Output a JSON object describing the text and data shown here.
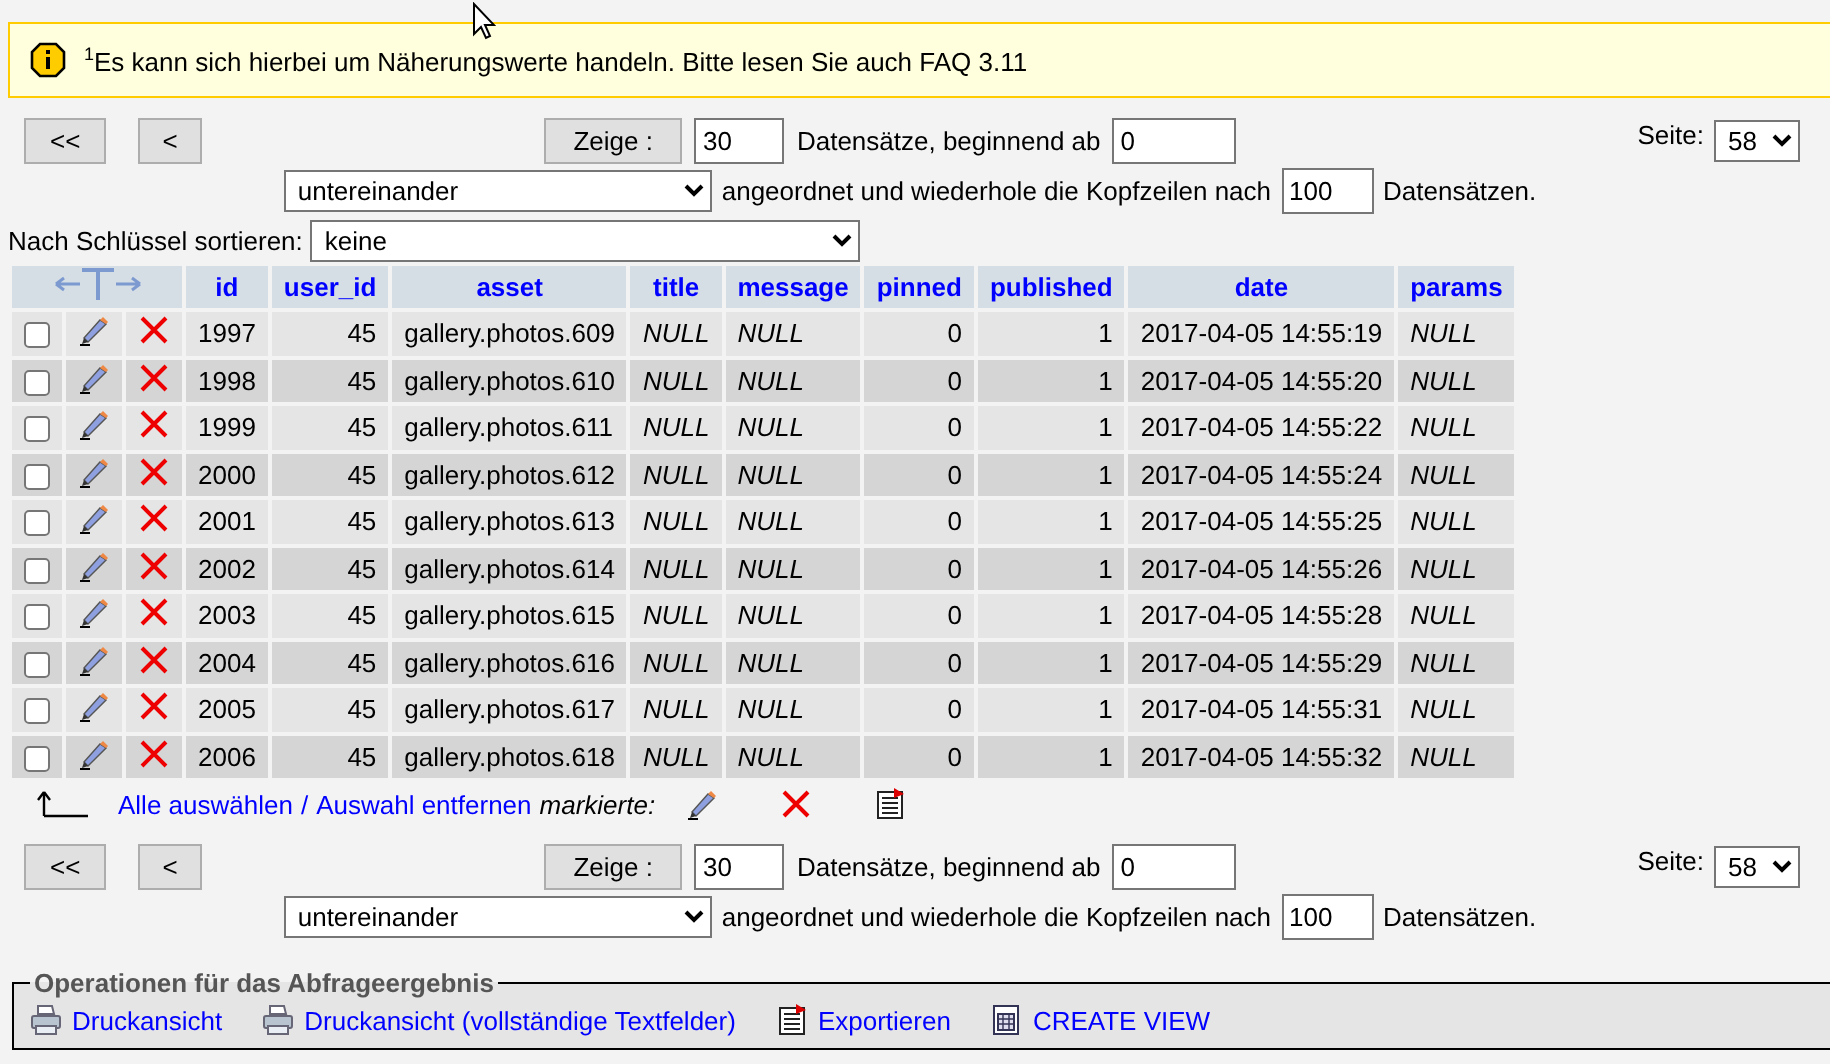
{
  "notice": {
    "text": "$^{1}$Es kann sich hierbei um Näherungswerte handeln. Bitte lesen Sie auch FAQ 3.11"
  },
  "navigation": [
    {
      "first_button": "<<",
      "prev_button": "<",
      "show_button": "Zeige :",
      "count": "30",
      "records_from_label": "Datensätze, beginnend ab",
      "start": "0",
      "display_mode": "untereinander",
      "repeat_label": "angeordnet und wiederhole die Kopfzeilen nach",
      "repeat": "100",
      "records_label": "Datensätzen.",
      "page_label": "Seite:",
      "page": "58",
      "sort_label": "Nach Schlüssel sortieren:",
      "sort": "keine"
    },
    {
      "first_button": "<<",
      "prev_button": "<",
      "show_button": "Zeige :",
      "count": "30",
      "records_from_label": "Datensätze, beginnend ab",
      "start": "0",
      "display_mode": "untereinander",
      "repeat_label": "angeordnet und wiederhole die Kopfzeilen nach",
      "repeat": "100",
      "records_label": "Datensätzen.",
      "page_label": "Seite:",
      "page": "58"
    }
  ],
  "table": {
    "columns": [
      "id",
      "user_id",
      "asset",
      "title",
      "message",
      "pinned",
      "published",
      "date",
      "params"
    ],
    "rows": [
      {
        "checked": false,
        "cells": [
          "1997",
          "45",
          "gallery.photos.609",
          "NULL",
          "NULL",
          "0",
          "1",
          "2017-04-05 14:55:19",
          "NULL"
        ]
      },
      {
        "checked": false,
        "cells": [
          "1998",
          "45",
          "gallery.photos.610",
          "NULL",
          "NULL",
          "0",
          "1",
          "2017-04-05 14:55:20",
          "NULL"
        ]
      },
      {
        "checked": false,
        "cells": [
          "1999",
          "45",
          "gallery.photos.611",
          "NULL",
          "NULL",
          "0",
          "1",
          "2017-04-05 14:55:22",
          "NULL"
        ]
      },
      {
        "checked": false,
        "cells": [
          "2000",
          "45",
          "gallery.photos.612",
          "NULL",
          "NULL",
          "0",
          "1",
          "2017-04-05 14:55:24",
          "NULL"
        ]
      },
      {
        "checked": false,
        "cells": [
          "2001",
          "45",
          "gallery.photos.613",
          "NULL",
          "NULL",
          "0",
          "1",
          "2017-04-05 14:55:25",
          "NULL"
        ]
      },
      {
        "checked": false,
        "cells": [
          "2002",
          "45",
          "gallery.photos.614",
          "NULL",
          "NULL",
          "0",
          "1",
          "2017-04-05 14:55:26",
          "NULL"
        ]
      },
      {
        "checked": false,
        "cells": [
          "2003",
          "45",
          "gallery.photos.615",
          "NULL",
          "NULL",
          "0",
          "1",
          "2017-04-05 14:55:28",
          "NULL"
        ]
      },
      {
        "checked": false,
        "cells": [
          "2004",
          "45",
          "gallery.photos.616",
          "NULL",
          "NULL",
          "0",
          "1",
          "2017-04-05 14:55:29",
          "NULL"
        ]
      },
      {
        "checked": false,
        "cells": [
          "2005",
          "45",
          "gallery.photos.617",
          "NULL",
          "NULL",
          "0",
          "1",
          "2017-04-05 14:55:31",
          "NULL"
        ]
      },
      {
        "checked": false,
        "cells": [
          "2006",
          "45",
          "gallery.photos.618",
          "NULL",
          "NULL",
          "0",
          "1",
          "2017-04-05 14:55:32",
          "NULL"
        ]
      }
    ]
  },
  "selection": {
    "select_all": "Alle auswählen",
    "separator": "/",
    "deselect_all": "Auswahl entfernen",
    "with_selected": "markierte:"
  },
  "operations": {
    "legend": "Operationen für das Abfrageergebnis",
    "links": [
      {
        "kind": "print",
        "label": "Druckansicht"
      },
      {
        "kind": "print",
        "label": "Druckansicht (vollständige Textfelder)"
      },
      {
        "kind": "export",
        "label": "Exportieren"
      },
      {
        "kind": "view",
        "label": "CREATE VIEW"
      }
    ]
  }
}
